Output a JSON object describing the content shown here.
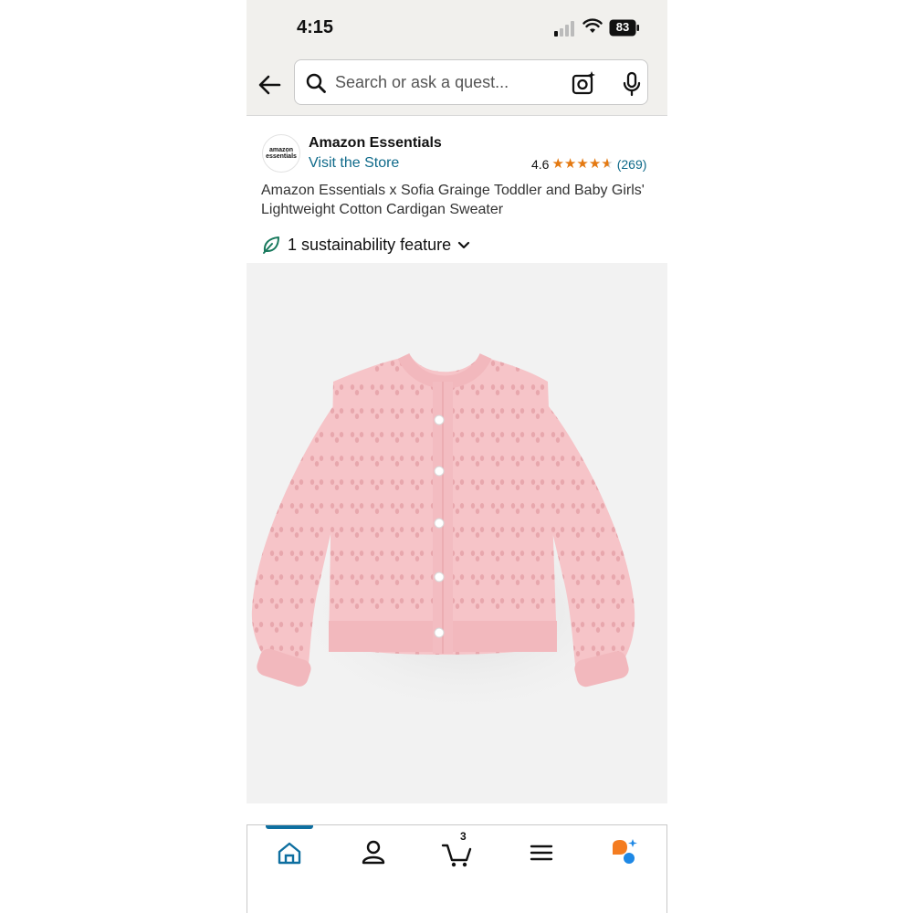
{
  "status_bar": {
    "time": "4:15",
    "battery": "83"
  },
  "search": {
    "placeholder": "Search or ask a quest..."
  },
  "brand": {
    "logo_text_1": "amazon",
    "logo_text_2": "essentials",
    "name": "Amazon Essentials",
    "visit_store": "Visit the Store",
    "rating": "4.6",
    "rating_count": "(269)",
    "stars": 4.6
  },
  "product": {
    "title": "Amazon Essentials x Sofia Grainge Toddler and Baby Girls' Lightweight Cotton Cardigan Sweater"
  },
  "sustainability": {
    "label": "1 sustainability feature"
  },
  "tab_bar": {
    "cart_count": "3"
  },
  "colors": {
    "accent_blue": "#0e6fa0",
    "link": "#0f6a8a",
    "star": "#e47911",
    "sweater": "#f6c4c8",
    "leaf": "#1a7a5e"
  }
}
